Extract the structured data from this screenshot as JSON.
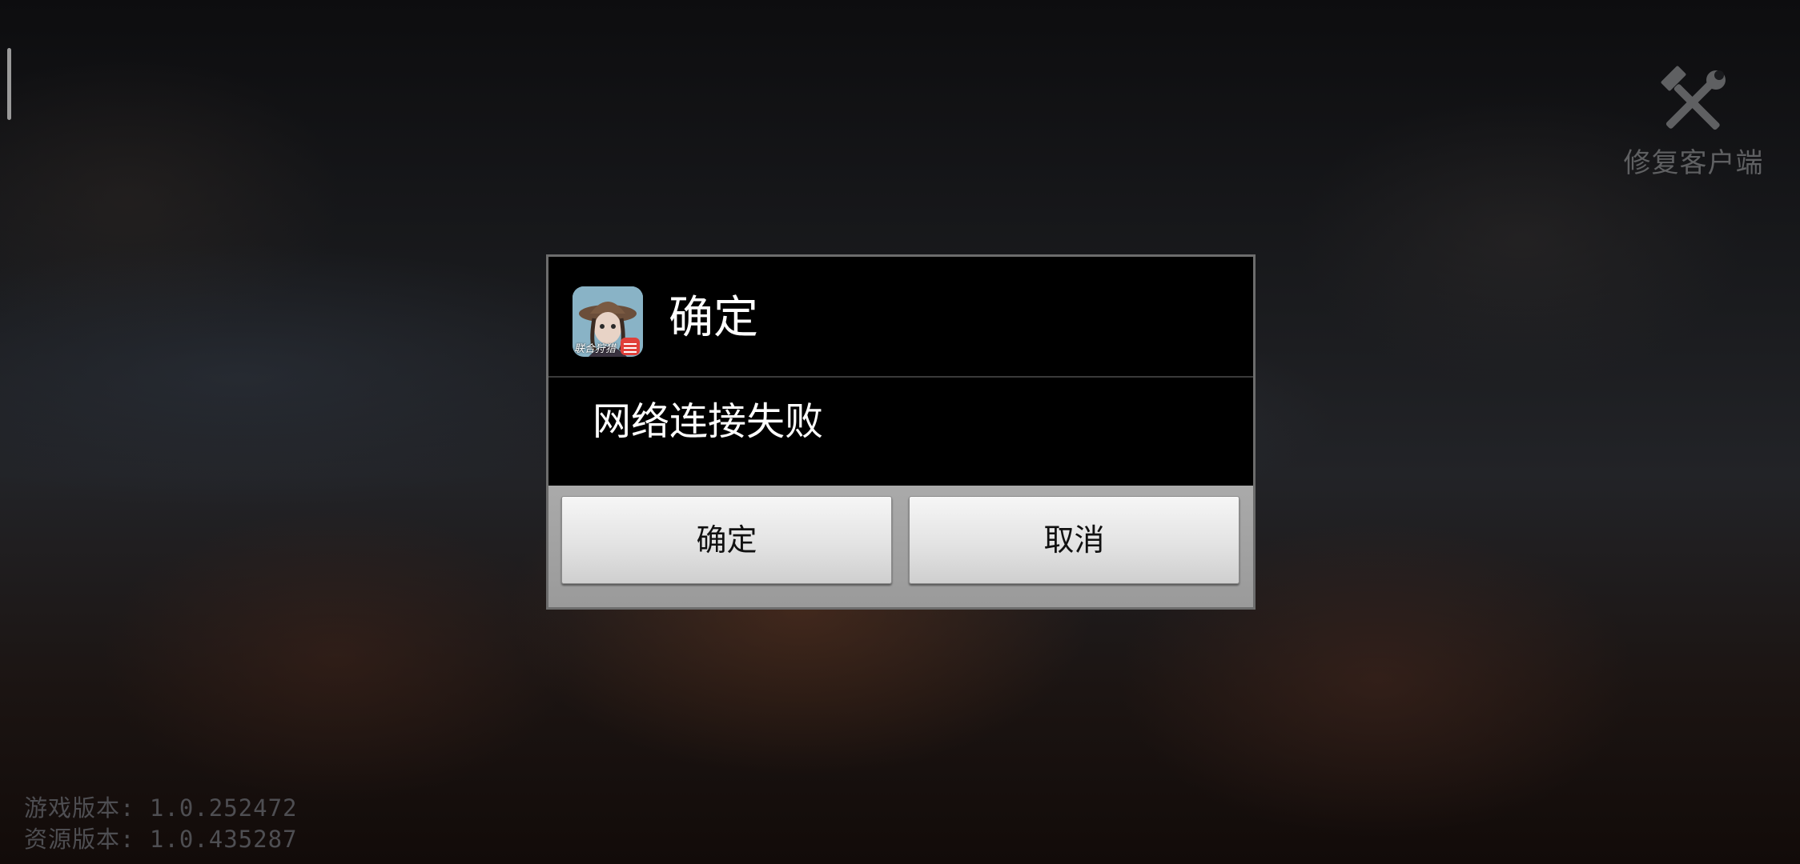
{
  "repair": {
    "label": "修复客户端",
    "icon": "wrench-hammer-icon"
  },
  "versions": {
    "game": "游戏版本: 1.0.252472",
    "resource": "资源版本: 1.0.435287"
  },
  "dialog": {
    "title": "确定",
    "message": "网络连接失败",
    "app_icon_text": "联合狩猎",
    "ok_label": "确定",
    "cancel_label": "取消"
  },
  "colors": {
    "dialog_bg": "#000000",
    "button_bar": "#a0a0a0",
    "button_face": "#e6e6e6",
    "dim_text": "#5f6062"
  }
}
